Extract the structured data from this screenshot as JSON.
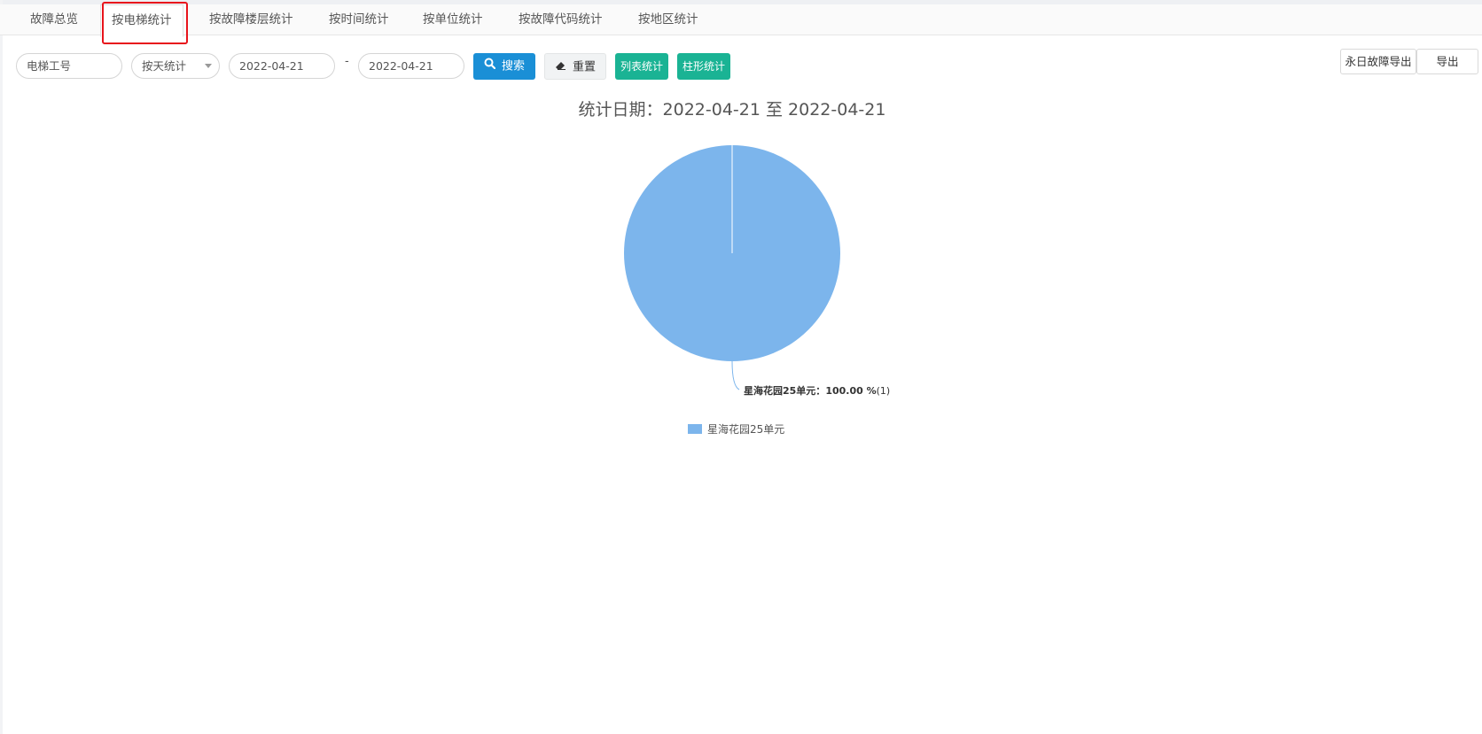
{
  "tabs": [
    {
      "label": "故障总览",
      "active": false
    },
    {
      "label": "按电梯统计",
      "active": true
    },
    {
      "label": "按故障楼层统计",
      "active": false
    },
    {
      "label": "按时间统计",
      "active": false
    },
    {
      "label": "按单位统计",
      "active": false
    },
    {
      "label": "按故障代码统计",
      "active": false
    },
    {
      "label": "按地区统计",
      "active": false
    }
  ],
  "filters": {
    "elevator_no": {
      "value": "电梯工号"
    },
    "period": {
      "value": "按天统计"
    },
    "start_date": {
      "value": "2022-04-21"
    },
    "separator": "-",
    "end_date": {
      "value": "2022-04-21"
    }
  },
  "buttons": {
    "search": "搜索",
    "reset": "重置",
    "list_stats": "列表统计",
    "bar_stats": "柱形统计",
    "daily_export": "永日故障导出",
    "export": "导出"
  },
  "colors": {
    "primary": "#1a8fd6",
    "success": "#1ab394",
    "slice": "#7cb5ec",
    "highlight": "#e8141c"
  },
  "chart_data": {
    "type": "pie",
    "title": "统计日期：2022-04-21 至 2022-04-21",
    "slices": [
      {
        "name": "星海花园25单元",
        "value": 1,
        "percent": 100.0
      }
    ],
    "data_label": {
      "name": "星海花园25单元：",
      "percent": "100.00 %",
      "count": "(1)"
    },
    "legend": {
      "position": "bottom",
      "entries": [
        "星海花园25单元"
      ]
    }
  }
}
